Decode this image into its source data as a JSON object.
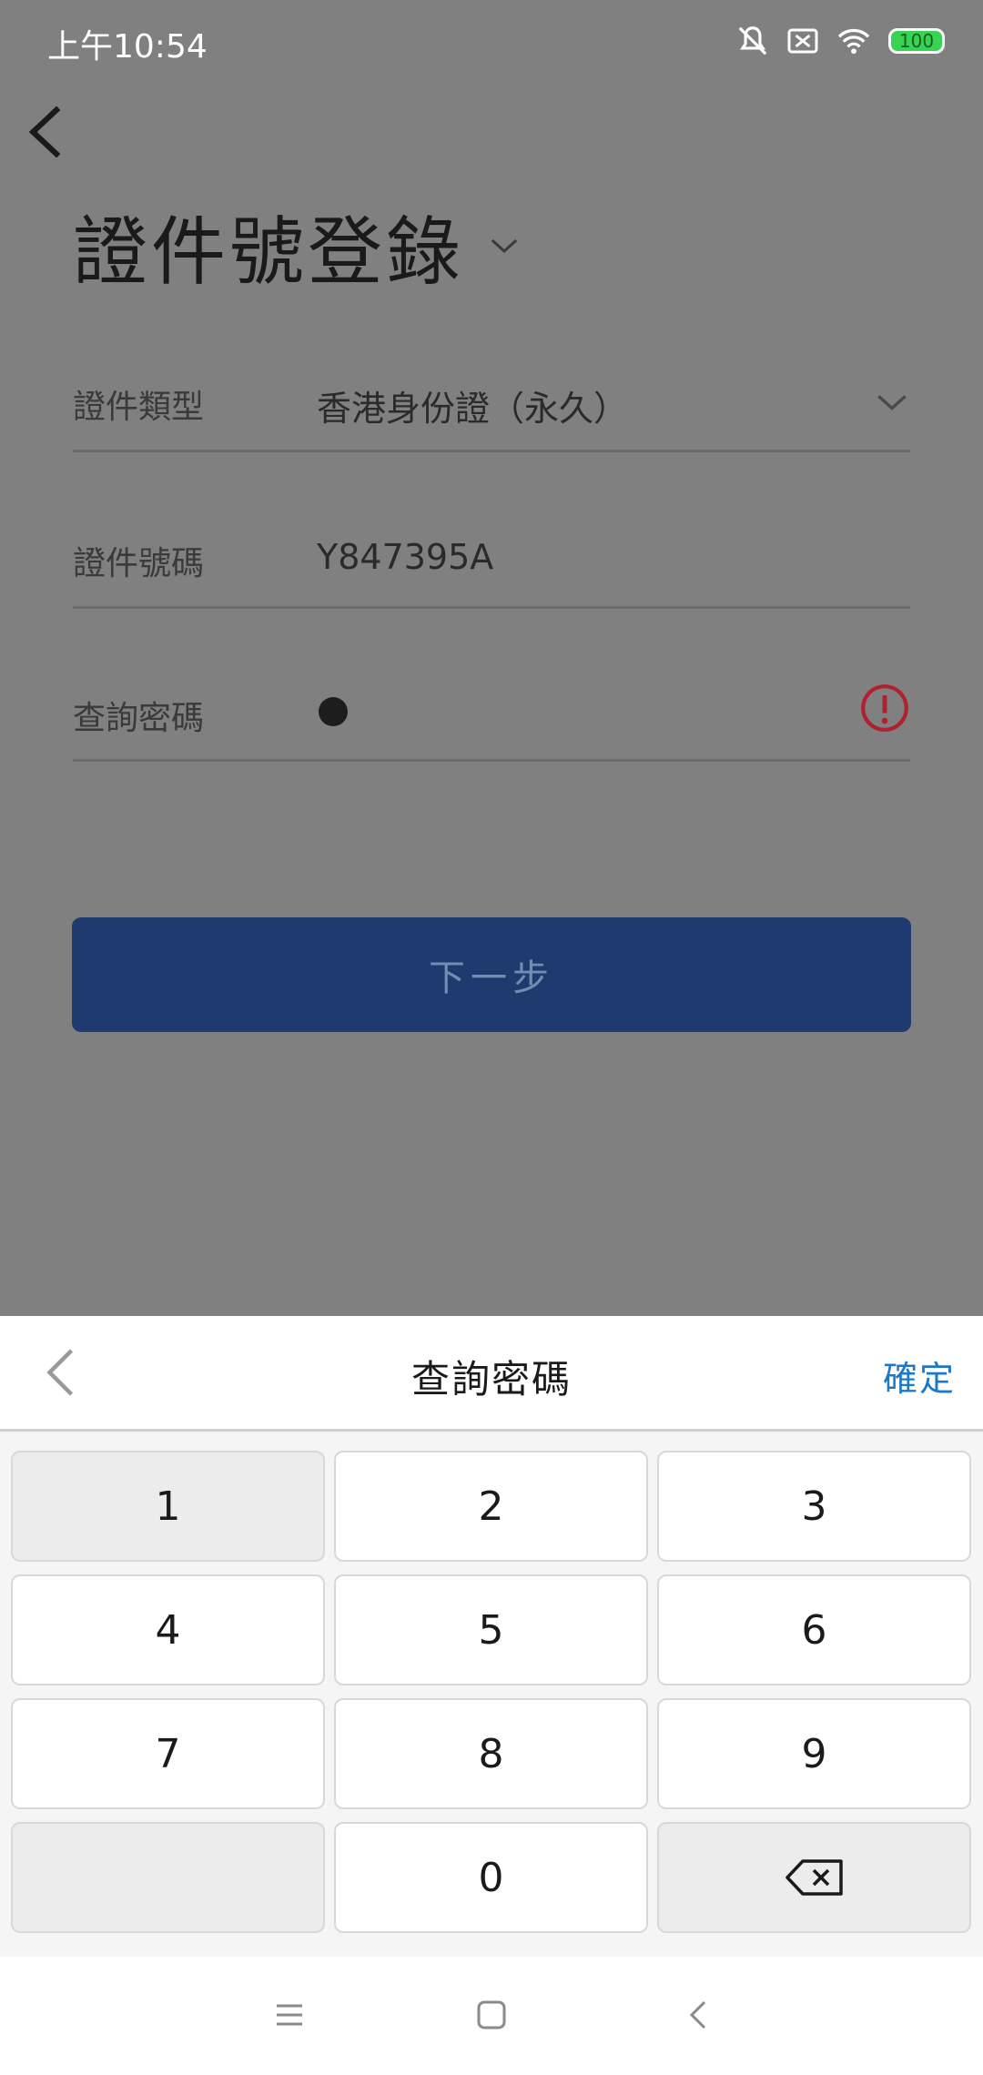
{
  "status_bar": {
    "time": "上午10:54",
    "battery": "100"
  },
  "header": {
    "title": "證件號登錄"
  },
  "form": {
    "doc_type": {
      "label": "證件類型",
      "value": "香港身份證（永久）"
    },
    "doc_number": {
      "label": "證件號碼",
      "value": "Y847395A"
    },
    "query_password": {
      "label": "查詢密碼",
      "masked_chars": 1
    }
  },
  "next_button": {
    "label": "下一步"
  },
  "keypad": {
    "title": "查詢密碼",
    "confirm_label": "確定",
    "keys": [
      "1",
      "2",
      "3",
      "4",
      "5",
      "6",
      "7",
      "8",
      "9",
      "",
      "0",
      "backspace"
    ]
  },
  "colors": {
    "primary": "#1e3a6e",
    "link": "#1e78c8",
    "warning": "#b0202e"
  }
}
